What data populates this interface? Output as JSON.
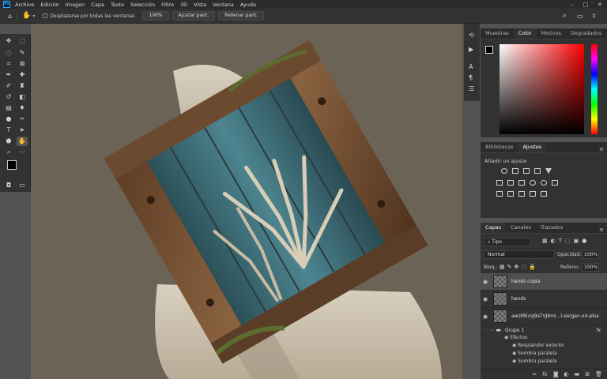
{
  "menubar": {
    "logo": "Ps",
    "items": [
      "Archivo",
      "Edición",
      "Imagen",
      "Capa",
      "Texto",
      "Selección",
      "Filtro",
      "3D",
      "Vista",
      "Ventana",
      "Ayuda"
    ]
  },
  "options": {
    "scroll_all_label": "Desplazarse por todas las ventanas",
    "zoom": "100%",
    "fit_label": "Ajustar pant.",
    "fill_label": "Rellenar pant."
  },
  "panels": {
    "top_tabs": [
      "Muestras",
      "Color",
      "Motivos",
      "Degradados"
    ],
    "mid_tabs": [
      "Bibliotecas",
      "Ajustes"
    ],
    "adjust_title": "Añadir un ajuste",
    "layer_tabs": [
      "Capas",
      "Canales",
      "Trazados"
    ],
    "kind_filter": "Tipo",
    "blend_mode": "Normal",
    "opacity_label": "Opacidad:",
    "opacity_value": "100%",
    "lock_label": "Bloq.:",
    "fill_label": "Relleno:",
    "fill_value": "100%"
  },
  "layers": [
    {
      "name": "hands copia",
      "selected": true
    },
    {
      "name": "hands",
      "selected": false
    },
    {
      "name": "awzMEcsJ9sTVJ9mi...l-esrgan-x4-plus",
      "selected": false
    }
  ],
  "group": {
    "name": "Grupo 1",
    "fx": "fx",
    "effects_label": "Efectos",
    "effects": [
      "Resplandor exterior",
      "Sombra paralela",
      "Sombra paralela"
    ]
  },
  "colors": {
    "accent": "#31a8ff",
    "canvas_bg": "#6b6356"
  }
}
